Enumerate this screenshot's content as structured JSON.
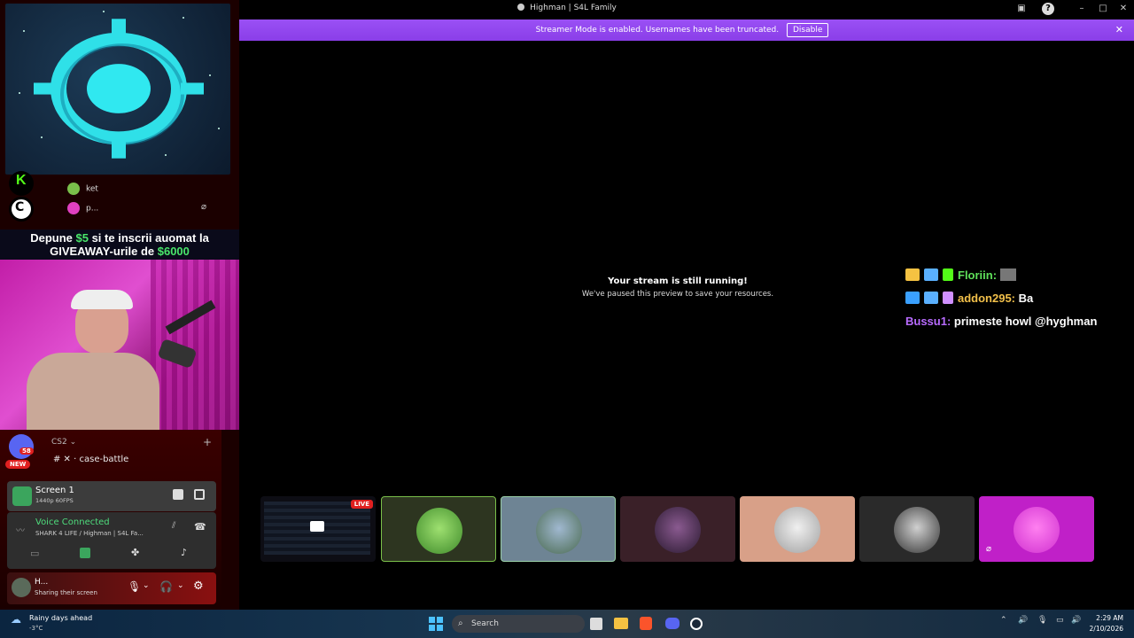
{
  "window": {
    "title": "Highman | S4L Family"
  },
  "banner": {
    "text": "Streamer Mode is enabled. Usernames have been truncated.",
    "button": "Disable"
  },
  "promo": {
    "line1_a": "Depune ",
    "line1_money": "$5",
    "line1_b": " si te inscrii auomat la",
    "line2_a": "GIVEAWAY-urile de ",
    "line2_money": "$6000"
  },
  "voice_users": [
    {
      "name": "ket"
    },
    {
      "name": "p..."
    }
  ],
  "channels": {
    "category": "CS2",
    "badge_count": "58",
    "new_badge": "NEW",
    "channel_name": "case-battle"
  },
  "screen_card": {
    "title": "Screen 1",
    "quality": "1440p 60FPS"
  },
  "voice_card": {
    "status": "Voice Connected",
    "location": "SHARK 4 LIFE / Highman | S4L Fa..."
  },
  "user_card": {
    "name": "H...",
    "status": "Sharing their screen"
  },
  "stream": {
    "heading": "Your stream is still running!",
    "subtext": "We've paused this preview to save your resources."
  },
  "chat": [
    {
      "user": "Floriin:",
      "message": "",
      "color": "#5fe15a"
    },
    {
      "user": "addon295:",
      "message": "Ba",
      "color": "#f2c04a"
    },
    {
      "user": "Bussu1:",
      "message": "primeste howl @hyghman",
      "color": "#b86bff"
    }
  ],
  "participants": {
    "live_label": "LIVE"
  },
  "taskbar": {
    "weather_title": "Rainy days ahead",
    "weather_temp": "-3°C",
    "search": "Search",
    "time": "2:29 AM",
    "date": "2/10/2026"
  },
  "colors": {
    "accent": "#9146ff",
    "live": "#e02020",
    "promo_money": "#49e66a"
  }
}
